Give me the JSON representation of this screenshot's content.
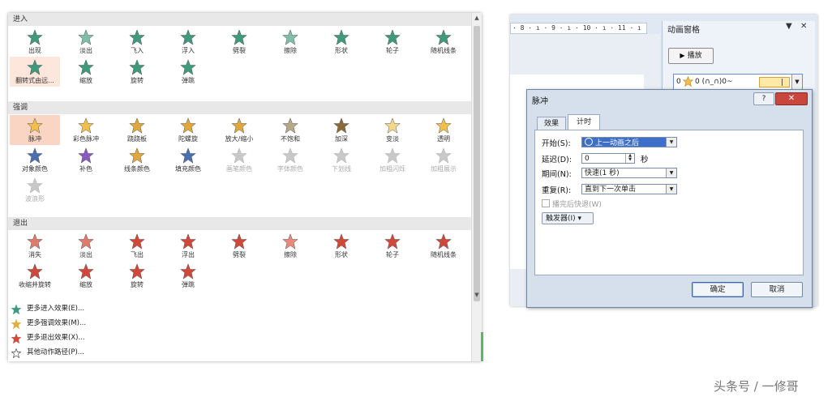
{
  "gallery": {
    "sections": [
      {
        "title": "进入",
        "items": [
          {
            "label": "出现",
            "color": "#3e9a7a",
            "state": "normal"
          },
          {
            "label": "淡出",
            "color": "#7fbfa8",
            "state": "normal"
          },
          {
            "label": "飞入",
            "color": "#3e9a7a",
            "state": "normal"
          },
          {
            "label": "浮入",
            "color": "#3e9a7a",
            "state": "normal"
          },
          {
            "label": "劈裂",
            "color": "#3e9a7a",
            "state": "normal"
          },
          {
            "label": "擦除",
            "color": "#7fbfa8",
            "state": "normal"
          },
          {
            "label": "形状",
            "color": "#3e9a7a",
            "state": "normal"
          },
          {
            "label": "轮子",
            "color": "#3e9a7a",
            "state": "normal"
          },
          {
            "label": "随机线条",
            "color": "#3e9a7a",
            "state": "normal"
          },
          {
            "label": "翻转式由远...",
            "color": "#3e9a7a",
            "state": "selected-light"
          },
          {
            "label": "缩放",
            "color": "#3e9a7a",
            "state": "normal"
          },
          {
            "label": "旋转",
            "color": "#3e9a7a",
            "state": "normal"
          },
          {
            "label": "弹跳",
            "color": "#3e9a7a",
            "state": "normal"
          }
        ]
      },
      {
        "title": "强调",
        "items": [
          {
            "label": "脉冲",
            "color": "#f2c04a",
            "state": "selected"
          },
          {
            "label": "彩色脉冲",
            "color": "#f2c04a",
            "state": "normal"
          },
          {
            "label": "跷跷板",
            "color": "#e0a83a",
            "state": "normal"
          },
          {
            "label": "陀螺旋",
            "color": "#e0a83a",
            "state": "normal"
          },
          {
            "label": "放大/缩小",
            "color": "#e0a83a",
            "state": "normal"
          },
          {
            "label": "不饱和",
            "color": "#b8a88a",
            "state": "normal"
          },
          {
            "label": "加深",
            "color": "#8a6a3a",
            "state": "normal"
          },
          {
            "label": "变淡",
            "color": "#f4d78a",
            "state": "normal"
          },
          {
            "label": "透明",
            "color": "#f2c04a",
            "state": "normal"
          },
          {
            "label": "对象颜色",
            "color": "#4a6fb0",
            "state": "normal"
          },
          {
            "label": "补色",
            "color": "#8a5ac0",
            "state": "normal"
          },
          {
            "label": "线条颜色",
            "color": "#e0a83a",
            "state": "normal"
          },
          {
            "label": "填充颜色",
            "color": "#4a6fb0",
            "state": "normal"
          },
          {
            "label": "画笔颜色",
            "color": "#c8c8c8",
            "state": "disabled"
          },
          {
            "label": "字体颜色",
            "color": "#c8c8c8",
            "state": "disabled"
          },
          {
            "label": "下划线",
            "color": "#c8c8c8",
            "state": "disabled"
          },
          {
            "label": "加粗闪烁",
            "color": "#c8c8c8",
            "state": "disabled"
          },
          {
            "label": "加粗展示",
            "color": "#c8c8c8",
            "state": "disabled"
          },
          {
            "label": "波浪形",
            "color": "#c8c8c8",
            "state": "disabled"
          }
        ]
      },
      {
        "title": "退出",
        "items": [
          {
            "label": "消失",
            "color": "#e07a6a",
            "state": "normal"
          },
          {
            "label": "淡出",
            "color": "#e07a6a",
            "state": "normal"
          },
          {
            "label": "飞出",
            "color": "#d0483a",
            "state": "normal"
          },
          {
            "label": "浮出",
            "color": "#d0483a",
            "state": "normal"
          },
          {
            "label": "劈裂",
            "color": "#d0483a",
            "state": "normal"
          },
          {
            "label": "擦除",
            "color": "#e88a7a",
            "state": "normal"
          },
          {
            "label": "形状",
            "color": "#d0483a",
            "state": "normal"
          },
          {
            "label": "轮子",
            "color": "#d0483a",
            "state": "normal"
          },
          {
            "label": "随机线条",
            "color": "#d0483a",
            "state": "normal"
          },
          {
            "label": "收缩并旋转",
            "color": "#d0483a",
            "state": "normal"
          },
          {
            "label": "缩放",
            "color": "#d0483a",
            "state": "normal"
          },
          {
            "label": "旋转",
            "color": "#d0483a",
            "state": "normal"
          },
          {
            "label": "弹跳",
            "color": "#d0483a",
            "state": "normal"
          }
        ]
      }
    ],
    "more_links": [
      {
        "label": "更多进入效果(E)...",
        "color": "#3e9a7a",
        "outline": false
      },
      {
        "label": "更多强调效果(M)...",
        "color": "#e0b040",
        "outline": false
      },
      {
        "label": "更多退出效果(X)...",
        "color": "#d0483a",
        "outline": false
      },
      {
        "label": "其他动作路径(P)...",
        "color": "#ffffff",
        "outline": true
      }
    ]
  },
  "ppt": {
    "ruler_text": "· 8 · ı · 9 · ı · 10 · ı · 11 · ı · 12 · ı",
    "anim_pane": {
      "title": "动画窗格",
      "dropdown_glyph": "▼",
      "close_glyph": "✕",
      "play_label": "播放",
      "item_seq": "0",
      "item_name": "0 (∩_∩)0~",
      "item_star_color": "#f2c04a"
    }
  },
  "dialog": {
    "title": "脉冲",
    "help": "?",
    "close": "✕",
    "tabs": [
      "效果",
      "计时"
    ],
    "start_label": "开始(S):",
    "start_value": "上一动画之后",
    "delay_label": "延迟(D):",
    "delay_value": "0",
    "delay_unit": "秒",
    "duration_label": "期间(N):",
    "duration_value": "快速(1 秒)",
    "repeat_label": "重复(R):",
    "repeat_value": "直到下一次单击",
    "rewind_label": "播完后快退(W)",
    "trigger_label": "触发器(I) ▾",
    "ok_label": "确定",
    "cancel_label": "取消"
  },
  "watermark": "头条号 / 一修哥"
}
